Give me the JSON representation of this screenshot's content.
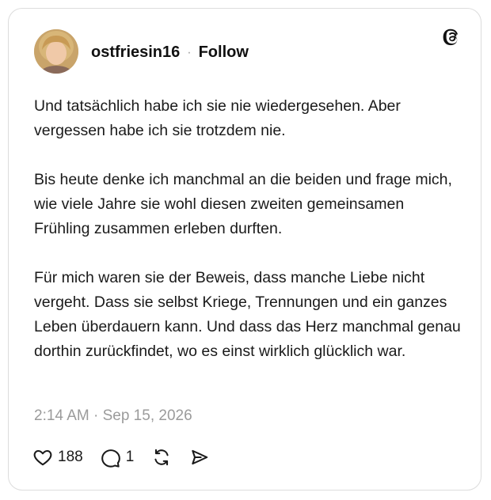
{
  "post": {
    "author": {
      "username": "ostfriesin16",
      "separator": "·",
      "follow_label": "Follow"
    },
    "app_logo_icon": "threads-logo-icon",
    "paragraphs": [
      "Und tatsächlich habe ich sie nie wiedergesehen. Aber vergessen habe ich sie trotzdem nie.",
      "Bis heute denke ich manchmal an die beiden und frage mich, wie viele Jahre sie wohl diesen zweiten gemeinsamen Frühling zusammen erleben durften.",
      "Für mich waren sie der Beweis, dass manche Liebe nicht vergeht. Dass sie selbst Kriege, Trennungen und ein ganzes Leben überdauern kann. Und dass das Herz manchmal genau dorthin zurückfindet, wo es einst wirklich glücklich war."
    ],
    "timestamp": "2:14 AM · Sep 15, 2026",
    "actions": {
      "likes": "188",
      "replies": "1",
      "like_icon": "heart-icon",
      "reply_icon": "comment-icon",
      "repost_icon": "repost-icon",
      "share_icon": "send-icon"
    }
  },
  "colors": {
    "border": "#dcdcdc",
    "text": "#1a1a1a",
    "muted": "#9b9b9b"
  }
}
